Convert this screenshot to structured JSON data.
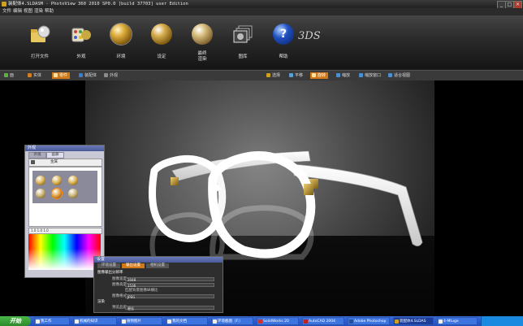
{
  "window": {
    "title": "装配体4.SLDASM - PhotoView 360 2010 SP0.0 [build 37703] user Edition",
    "controls": {
      "minimize": "_",
      "maximize": "□",
      "close": "×"
    }
  },
  "menu": [
    "文件",
    "编辑",
    "视图",
    "渲染",
    "帮助"
  ],
  "ribbon": [
    {
      "label": "打开文件",
      "icon": "open-folder-icon"
    },
    {
      "label": "外观",
      "icon": "appearance-icon"
    },
    {
      "label": "环境",
      "icon": "environment-sphere-icon"
    },
    {
      "label": "设定",
      "icon": "settings-gear-sphere-icon"
    },
    {
      "label": "最终\n渲染",
      "icon": "final-render-sphere-icon"
    },
    {
      "label": "图库",
      "icon": "image-gallery-icon"
    },
    {
      "label": "帮助",
      "icon": "help-sphere-icon"
    }
  ],
  "brand": "3DS",
  "tabs_left": [
    {
      "label": "面",
      "color": "#5ab040"
    },
    {
      "label": "实体",
      "color": "#d08020"
    },
    {
      "label": "零件",
      "color": "#c06018",
      "active": true
    },
    {
      "label": "装配体",
      "color": "#3a7ad0"
    },
    {
      "label": "外观",
      "color": "#8a8a8a"
    }
  ],
  "tabs_right": [
    {
      "label": "选择",
      "color": "#d0a020"
    },
    {
      "label": "平移",
      "color": "#5aa0d0"
    },
    {
      "label": "旋转",
      "color": "#d07018",
      "active": true
    },
    {
      "label": "缩放",
      "color": "#4a90d0"
    },
    {
      "label": "缩放窗口",
      "color": "#4a90d0"
    },
    {
      "label": "适合视图",
      "color": "#4a90d0"
    }
  ],
  "appearance_panel": {
    "title": "外观",
    "tabs": [
      "外观",
      "画廊"
    ],
    "tree_item": "金属",
    "color_values": [
      "1.0",
      "1.0",
      "1.0"
    ]
  },
  "output_panel": {
    "title": "设置",
    "tabs": [
      "环境设置",
      "输出设置",
      "相机设置"
    ],
    "section1": "图像输出分辨率",
    "rows": [
      {
        "label": "图像宽度",
        "value": "2048"
      },
      {
        "label": "图像高度",
        "value": "1536"
      }
    ],
    "checkbox": "匹配背景图像纵横比",
    "format_label": "图像格式",
    "format_value": "JPEG",
    "section2": "渲染",
    "quality_rows": [
      {
        "label": "预览品质",
        "value": "更佳"
      },
      {
        "label": "最终渲染品质",
        "value": "预览品质"
      }
    ]
  },
  "taskbar": {
    "start": "开始",
    "items": [
      "我工作",
      "机械的知识",
      "植物图片",
      "我的文档",
      "环境截图（F:）",
      "SolidWorks 20",
      "AutoCAD 2004",
      "Adobe Photoshop",
      "装配体4.SLDAS",
      "4-Mtuge"
    ],
    "active_index": 8
  }
}
